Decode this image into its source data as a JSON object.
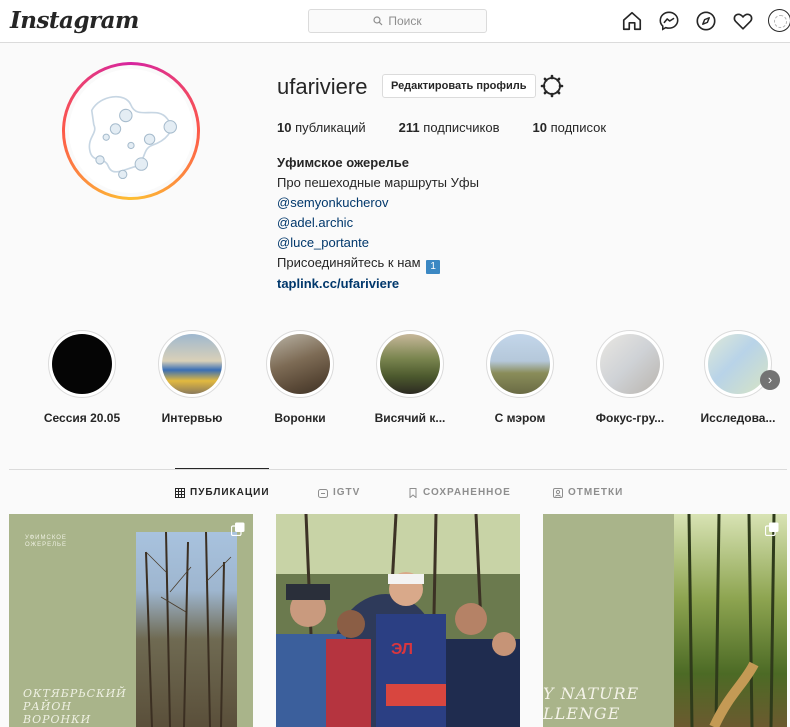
{
  "nav": {
    "logo": "Instagram",
    "search_placeholder": "Поиск"
  },
  "profile": {
    "username": "ufariviere",
    "edit_button": "Редактировать профиль",
    "stats": {
      "posts_count": "10",
      "posts_label": "публикаций",
      "followers_count": "211",
      "followers_label": "подписчиков",
      "following_count": "10",
      "following_label": "подписок"
    },
    "bio": {
      "name": "Уфимское ожерелье",
      "line1": "Про пешеходные маршруты Уфы",
      "mentions": [
        "@semyonkucherov",
        "@adel.archic",
        "@luce_portante"
      ],
      "join_text": "Присоединяйтесь к нам",
      "join_badge": "1",
      "link": "taplink.cc/ufariviere"
    }
  },
  "highlights": [
    {
      "label": "Сессия 20.05"
    },
    {
      "label": "Интервью"
    },
    {
      "label": "Воронки"
    },
    {
      "label": "Висячий к..."
    },
    {
      "label": "С мэром"
    },
    {
      "label": "Фокус-гру..."
    },
    {
      "label": "Исследова..."
    }
  ],
  "tabs": [
    {
      "label": "ПУБЛИКАЦИИ",
      "active": true
    },
    {
      "label": "IGTV",
      "active": false
    },
    {
      "label": "СОХРАНЕННОЕ",
      "active": false
    },
    {
      "label": "ОТМЕТКИ",
      "active": false
    }
  ],
  "posts": [
    {
      "brand_line1": "УФИМСКОЕ",
      "brand_line2": "ОЖЕРЕЛЬЕ",
      "title_line1": "ОКТЯБРЬСКИЙ",
      "title_line2": "РАЙОН",
      "title_line3": "ВОРОНКИ"
    },
    {},
    {
      "title_line1": "Y NATURE",
      "title_line2": "LLENGE"
    }
  ],
  "colors": {
    "post_green": "#a9b48a",
    "link": "#00376b"
  }
}
